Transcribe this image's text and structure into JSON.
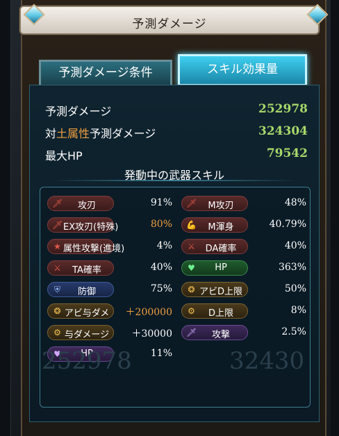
{
  "window": {
    "title": "予測ダメージ"
  },
  "tabs": [
    {
      "label": "予測ダメージ条件"
    },
    {
      "label": "スキル効果量"
    }
  ],
  "summary": {
    "predicted_label": "予測ダメージ",
    "predicted_value": "252978",
    "vs_prefix": "対",
    "vs_element": "土属性",
    "vs_suffix": "予測ダメージ",
    "vs_value": "324304",
    "maxhp_label": "最大HP",
    "maxhp_value": "79542"
  },
  "skills_title": "発動中の武器スキル",
  "skills": [
    {
      "name": "攻刃",
      "value": "91%",
      "icon": "sword-icon",
      "color": "red"
    },
    {
      "name": "M攻刃",
      "value": "48%",
      "icon": "sword-icon",
      "color": "red"
    },
    {
      "name": "EX攻刃(特殊)",
      "value": "80%",
      "icon": "sword-icon",
      "color": "red",
      "value_color": "orange"
    },
    {
      "name": "M渾身",
      "value": "40.79%",
      "icon": "arm-icon",
      "color": "red"
    },
    {
      "name": "属性攻撃(進境)",
      "value": "4%",
      "icon": "star-icon",
      "color": "red"
    },
    {
      "name": "DA確率",
      "value": "40%",
      "icon": "double-slash-icon",
      "color": "red"
    },
    {
      "name": "TA確率",
      "value": "40%",
      "icon": "triple-slash-icon",
      "color": "red"
    },
    {
      "name": "HP",
      "value": "363%",
      "icon": "heart-icon",
      "color": "green"
    },
    {
      "name": "防御",
      "value": "75%",
      "icon": "shield-icon",
      "color": "blue"
    },
    {
      "name": "アビD上限",
      "value": "50%",
      "icon": "ability-icon",
      "color": "gold"
    },
    {
      "name": "アビ与ダメ",
      "value": "＋200000",
      "icon": "ability-icon",
      "color": "gold",
      "value_color": "orange"
    },
    {
      "name": "D上限",
      "value": "8%",
      "icon": "gear-icon",
      "color": "gold"
    },
    {
      "name": "与ダメージ",
      "value": "＋30000",
      "icon": "gear-icon",
      "color": "gold"
    },
    {
      "name": "攻撃",
      "value": "2.5%",
      "icon": "purple-sword-icon",
      "color": "purple"
    },
    {
      "name": "HP",
      "value": "11%",
      "icon": "heart-icon",
      "color": "purple"
    }
  ],
  "background_numbers": [
    "252978",
    "32430"
  ]
}
